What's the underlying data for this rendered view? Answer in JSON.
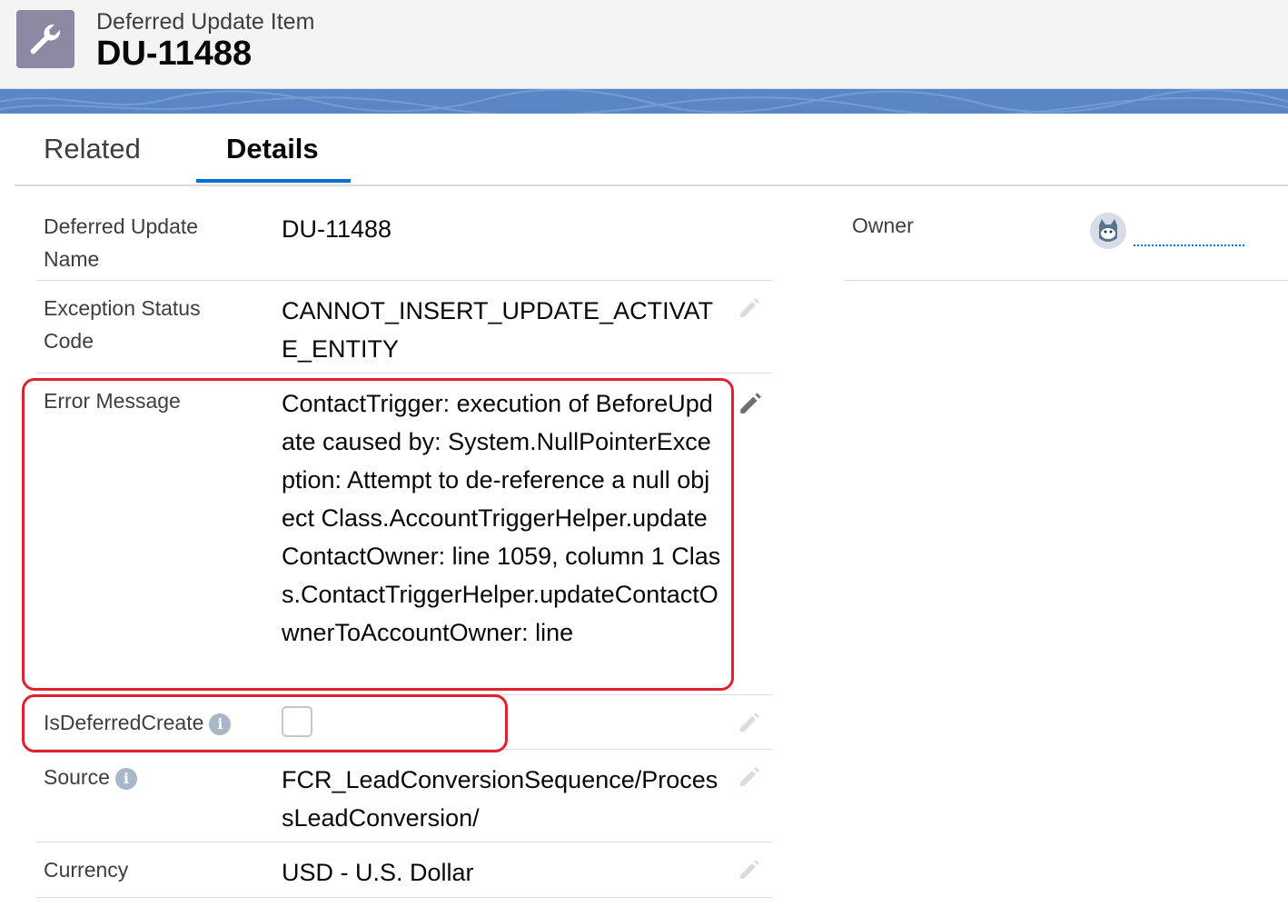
{
  "header": {
    "object_type": "Deferred Update Item",
    "record_name": "DU-11488",
    "icon": "wrench-icon"
  },
  "tabs": [
    {
      "label": "Related",
      "active": false
    },
    {
      "label": "Details",
      "active": true
    }
  ],
  "fields": {
    "deferred_update_name": {
      "label": "Deferred Update Name",
      "value": "DU-11488"
    },
    "exception_status_code": {
      "label": "Exception Status Code",
      "value": "CANNOT_INSERT_UPDATE_ACTIVATE_ENTITY"
    },
    "error_message": {
      "label": "Error Message",
      "value": "ContactTrigger: execution of BeforeUpdate caused by: System.NullPointerException: Attempt to de-reference a null object Class.AccountTriggerHelper.updateContactOwner: line 1059, column 1 Class.ContactTriggerHelper.updateContactOwnerToAccountOwner: line"
    },
    "is_deferred_create": {
      "label": "IsDeferredCreate",
      "checked": false
    },
    "source": {
      "label": "Source",
      "value": "FCR_LeadConversionSequence/ProcessLeadConversion/"
    },
    "currency": {
      "label": "Currency",
      "value": "USD - U.S. Dollar"
    }
  },
  "owner": {
    "label": "Owner",
    "value": ""
  },
  "colors": {
    "accent": "#0070d2",
    "highlight": "#e0212f",
    "banner": "#5b86c6"
  }
}
